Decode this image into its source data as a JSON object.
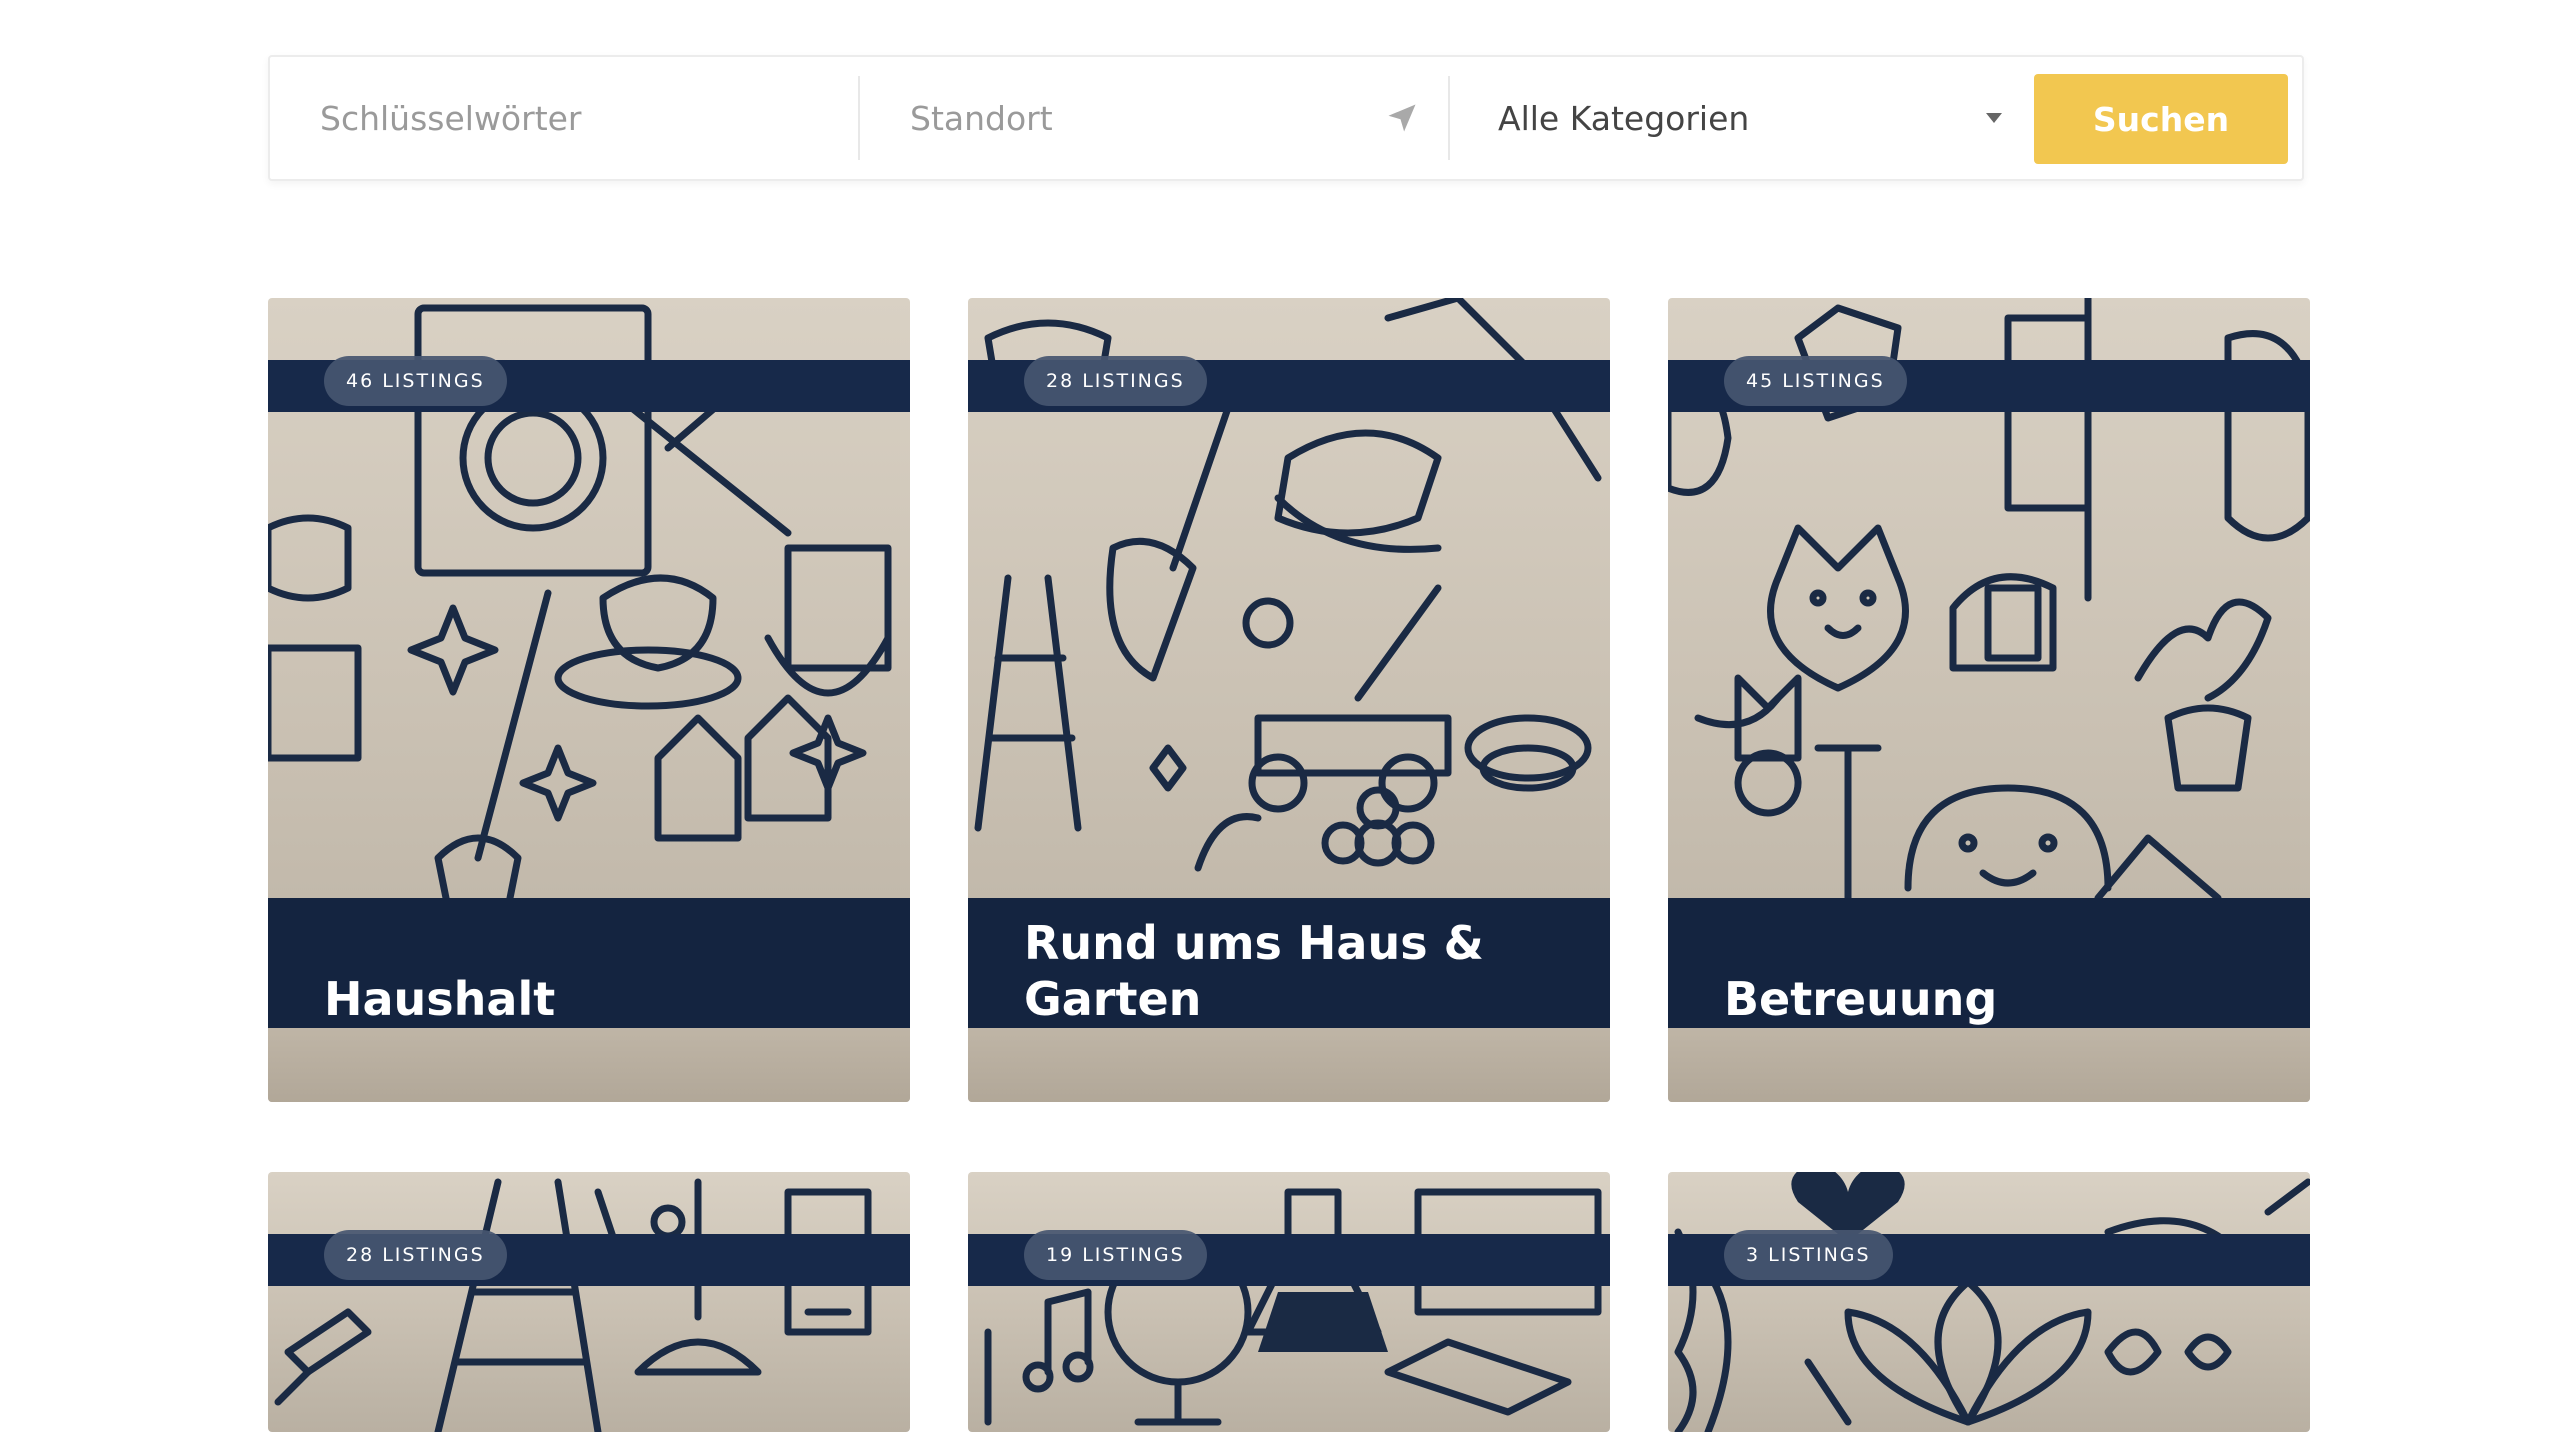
{
  "search": {
    "keywords_placeholder": "Schlüsselwörter",
    "location_placeholder": "Standort",
    "category_selected": "Alle Kategorien",
    "button_label": "Suchen"
  },
  "categories": [
    {
      "badge": "46 LISTINGS",
      "title": "Haushalt"
    },
    {
      "badge": "28 LISTINGS",
      "title": "Rund ums Haus & Garten"
    },
    {
      "badge": "45 LISTINGS",
      "title": "Betreuung"
    },
    {
      "badge": "28 LISTINGS",
      "title": ""
    },
    {
      "badge": "19 LISTINGS",
      "title": ""
    },
    {
      "badge": "3 LISTINGS",
      "title": ""
    }
  ],
  "colors": {
    "accent_button": "#f2c750",
    "card_band": "#17294a",
    "card_background": "#d2c9bb"
  },
  "icons": [
    "location-arrow-icon",
    "dropdown-caret-icon"
  ]
}
